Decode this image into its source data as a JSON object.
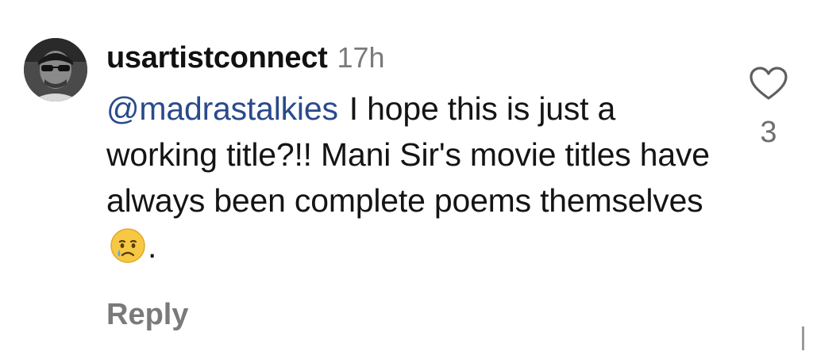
{
  "comment": {
    "username": "usartistconnect",
    "timestamp": "17h",
    "mention": "@madrastalkies",
    "text_before_emoji": "I hope this is just a working title?!! Mani Sir's movie titles have always been complete poems themselves",
    "emoji": "crying-face",
    "text_after_emoji": ".",
    "reply_label": "Reply",
    "like_count": "3"
  },
  "colors": {
    "mention": "#2a4a8c",
    "secondary_text": "#7a7a7a",
    "primary_text": "#141414"
  },
  "icons": {
    "avatar": "profile-photo",
    "like": "heart-outline-icon",
    "emoji": "crying-face-emoji"
  }
}
